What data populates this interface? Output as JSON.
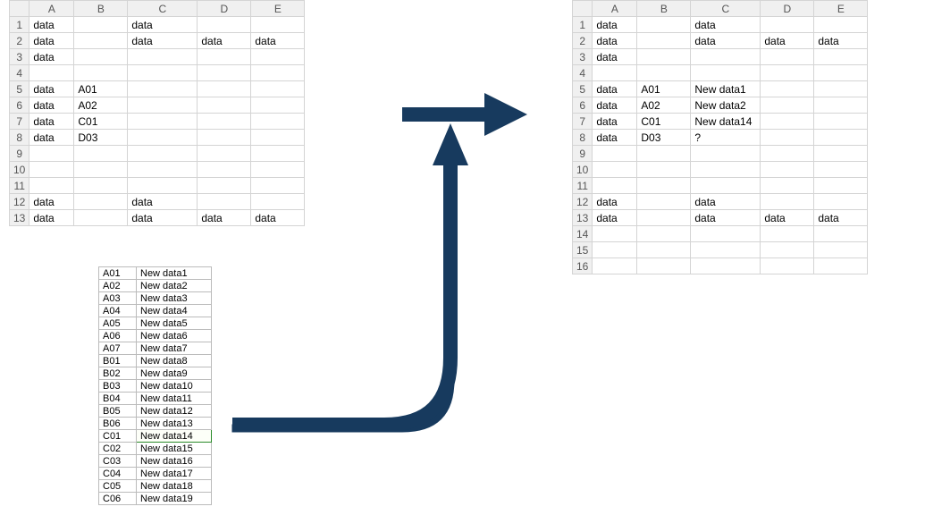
{
  "grid_left": {
    "columns": [
      "A",
      "B",
      "C",
      "D",
      "E"
    ],
    "rows": [
      {
        "n": "1",
        "A": "data",
        "B": "",
        "C": "data",
        "D": "",
        "E": ""
      },
      {
        "n": "2",
        "A": "data",
        "B": "",
        "C": "data",
        "D": "data",
        "E": "data"
      },
      {
        "n": "3",
        "A": "data",
        "B": "",
        "C": "",
        "D": "",
        "E": ""
      },
      {
        "n": "4",
        "A": "",
        "B": "",
        "C": "",
        "D": "",
        "E": ""
      },
      {
        "n": "5",
        "A": "data",
        "B": "A01",
        "C": "",
        "D": "",
        "E": ""
      },
      {
        "n": "6",
        "A": "data",
        "B": "A02",
        "C": "",
        "D": "",
        "E": ""
      },
      {
        "n": "7",
        "A": "data",
        "B": "C01",
        "C": "",
        "D": "",
        "E": ""
      },
      {
        "n": "8",
        "A": "data",
        "B": "D03",
        "C": "",
        "D": "",
        "E": ""
      },
      {
        "n": "9",
        "A": "",
        "B": "",
        "C": "",
        "D": "",
        "E": ""
      },
      {
        "n": "10",
        "A": "",
        "B": "",
        "C": "",
        "D": "",
        "E": ""
      },
      {
        "n": "11",
        "A": "",
        "B": "",
        "C": "",
        "D": "",
        "E": ""
      },
      {
        "n": "12",
        "A": "data",
        "B": "",
        "C": "data",
        "D": "",
        "E": ""
      },
      {
        "n": "13",
        "A": "data",
        "B": "",
        "C": "data",
        "D": "data",
        "E": "data"
      }
    ]
  },
  "grid_right": {
    "columns": [
      "A",
      "B",
      "C",
      "D",
      "E"
    ],
    "rows": [
      {
        "n": "1",
        "A": "data",
        "B": "",
        "C": "data",
        "D": "",
        "E": ""
      },
      {
        "n": "2",
        "A": "data",
        "B": "",
        "C": "data",
        "D": "data",
        "E": "data"
      },
      {
        "n": "3",
        "A": "data",
        "B": "",
        "C": "",
        "D": "",
        "E": ""
      },
      {
        "n": "4",
        "A": "",
        "B": "",
        "C": "",
        "D": "",
        "E": ""
      },
      {
        "n": "5",
        "A": "data",
        "B": "A01",
        "C": "New data1",
        "D": "",
        "E": ""
      },
      {
        "n": "6",
        "A": "data",
        "B": "A02",
        "C": "New data2",
        "D": "",
        "E": ""
      },
      {
        "n": "7",
        "A": "data",
        "B": "C01",
        "C": "New data14",
        "D": "",
        "E": ""
      },
      {
        "n": "8",
        "A": "data",
        "B": "D03",
        "C": "?",
        "D": "",
        "E": ""
      },
      {
        "n": "9",
        "A": "",
        "B": "",
        "C": "",
        "D": "",
        "E": ""
      },
      {
        "n": "10",
        "A": "",
        "B": "",
        "C": "",
        "D": "",
        "E": ""
      },
      {
        "n": "11",
        "A": "",
        "B": "",
        "C": "",
        "D": "",
        "E": ""
      },
      {
        "n": "12",
        "A": "data",
        "B": "",
        "C": "data",
        "D": "",
        "E": ""
      },
      {
        "n": "13",
        "A": "data",
        "B": "",
        "C": "data",
        "D": "data",
        "E": "data"
      },
      {
        "n": "14",
        "A": "",
        "B": "",
        "C": "",
        "D": "",
        "E": ""
      },
      {
        "n": "15",
        "A": "",
        "B": "",
        "C": "",
        "D": "",
        "E": ""
      },
      {
        "n": "16",
        "A": "",
        "B": "",
        "C": "",
        "D": "",
        "E": ""
      }
    ]
  },
  "lookup_table": {
    "rows": [
      {
        "k": "A01",
        "v": "New data1"
      },
      {
        "k": "A02",
        "v": "New data2"
      },
      {
        "k": "A03",
        "v": "New data3"
      },
      {
        "k": "A04",
        "v": "New data4"
      },
      {
        "k": "A05",
        "v": "New data5"
      },
      {
        "k": "A06",
        "v": "New data6"
      },
      {
        "k": "A07",
        "v": "New data7"
      },
      {
        "k": "B01",
        "v": "New data8"
      },
      {
        "k": "B02",
        "v": "New data9"
      },
      {
        "k": "B03",
        "v": "New data10"
      },
      {
        "k": "B04",
        "v": "New data11"
      },
      {
        "k": "B05",
        "v": "New data12"
      },
      {
        "k": "B06",
        "v": "New data13"
      },
      {
        "k": "C01",
        "v": "New data14",
        "hl": true
      },
      {
        "k": "C02",
        "v": "New data15"
      },
      {
        "k": "C03",
        "v": "New data16"
      },
      {
        "k": "C04",
        "v": "New data17"
      },
      {
        "k": "C05",
        "v": "New data18"
      },
      {
        "k": "C06",
        "v": "New data19"
      }
    ]
  },
  "arrow_color": "#173a5e"
}
